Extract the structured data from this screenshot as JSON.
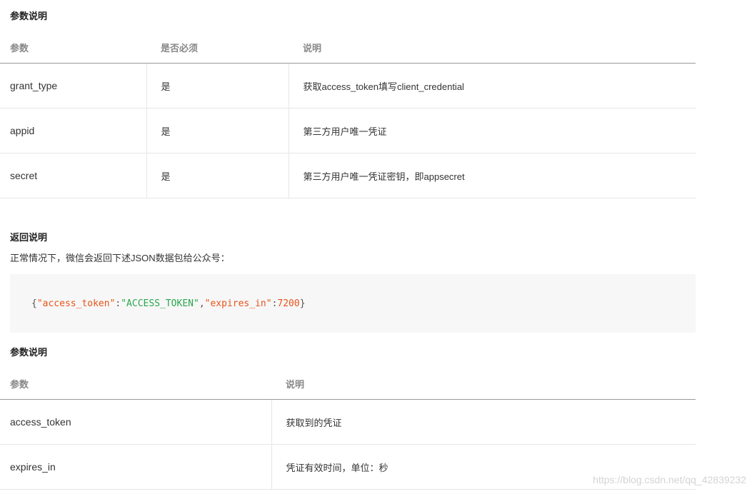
{
  "section1": {
    "title": "参数说明",
    "headers": [
      "参数",
      "是否必须",
      "说明"
    ],
    "rows": [
      {
        "param": "grant_type",
        "required": "是",
        "desc": "获取access_token填写client_credential"
      },
      {
        "param": "appid",
        "required": "是",
        "desc": "第三方用户唯一凭证"
      },
      {
        "param": "secret",
        "required": "是",
        "desc": "第三方用户唯一凭证密钥，即appsecret"
      }
    ]
  },
  "section2": {
    "title": "返回说明",
    "paragraph": "正常情况下，微信会返回下述JSON数据包给公众号：",
    "code": {
      "open": "{",
      "key1": "\"access_token\"",
      "colon1": ":",
      "val1": "\"ACCESS_TOKEN\"",
      "comma": ",",
      "key2": "\"expires_in\"",
      "colon2": ":",
      "val2": "7200",
      "close": "}"
    }
  },
  "section3": {
    "title": "参数说明",
    "headers": [
      "参数",
      "说明"
    ],
    "rows": [
      {
        "param": "access_token",
        "desc": "获取到的凭证"
      },
      {
        "param": "expires_in",
        "desc": "凭证有效时间，单位：秒"
      }
    ]
  },
  "watermark": "https://blog.csdn.net/qq_42839232",
  "colors": {
    "code_key": "#e8541a",
    "code_string": "#2aa64d",
    "code_bg": "#f7f7f7"
  }
}
